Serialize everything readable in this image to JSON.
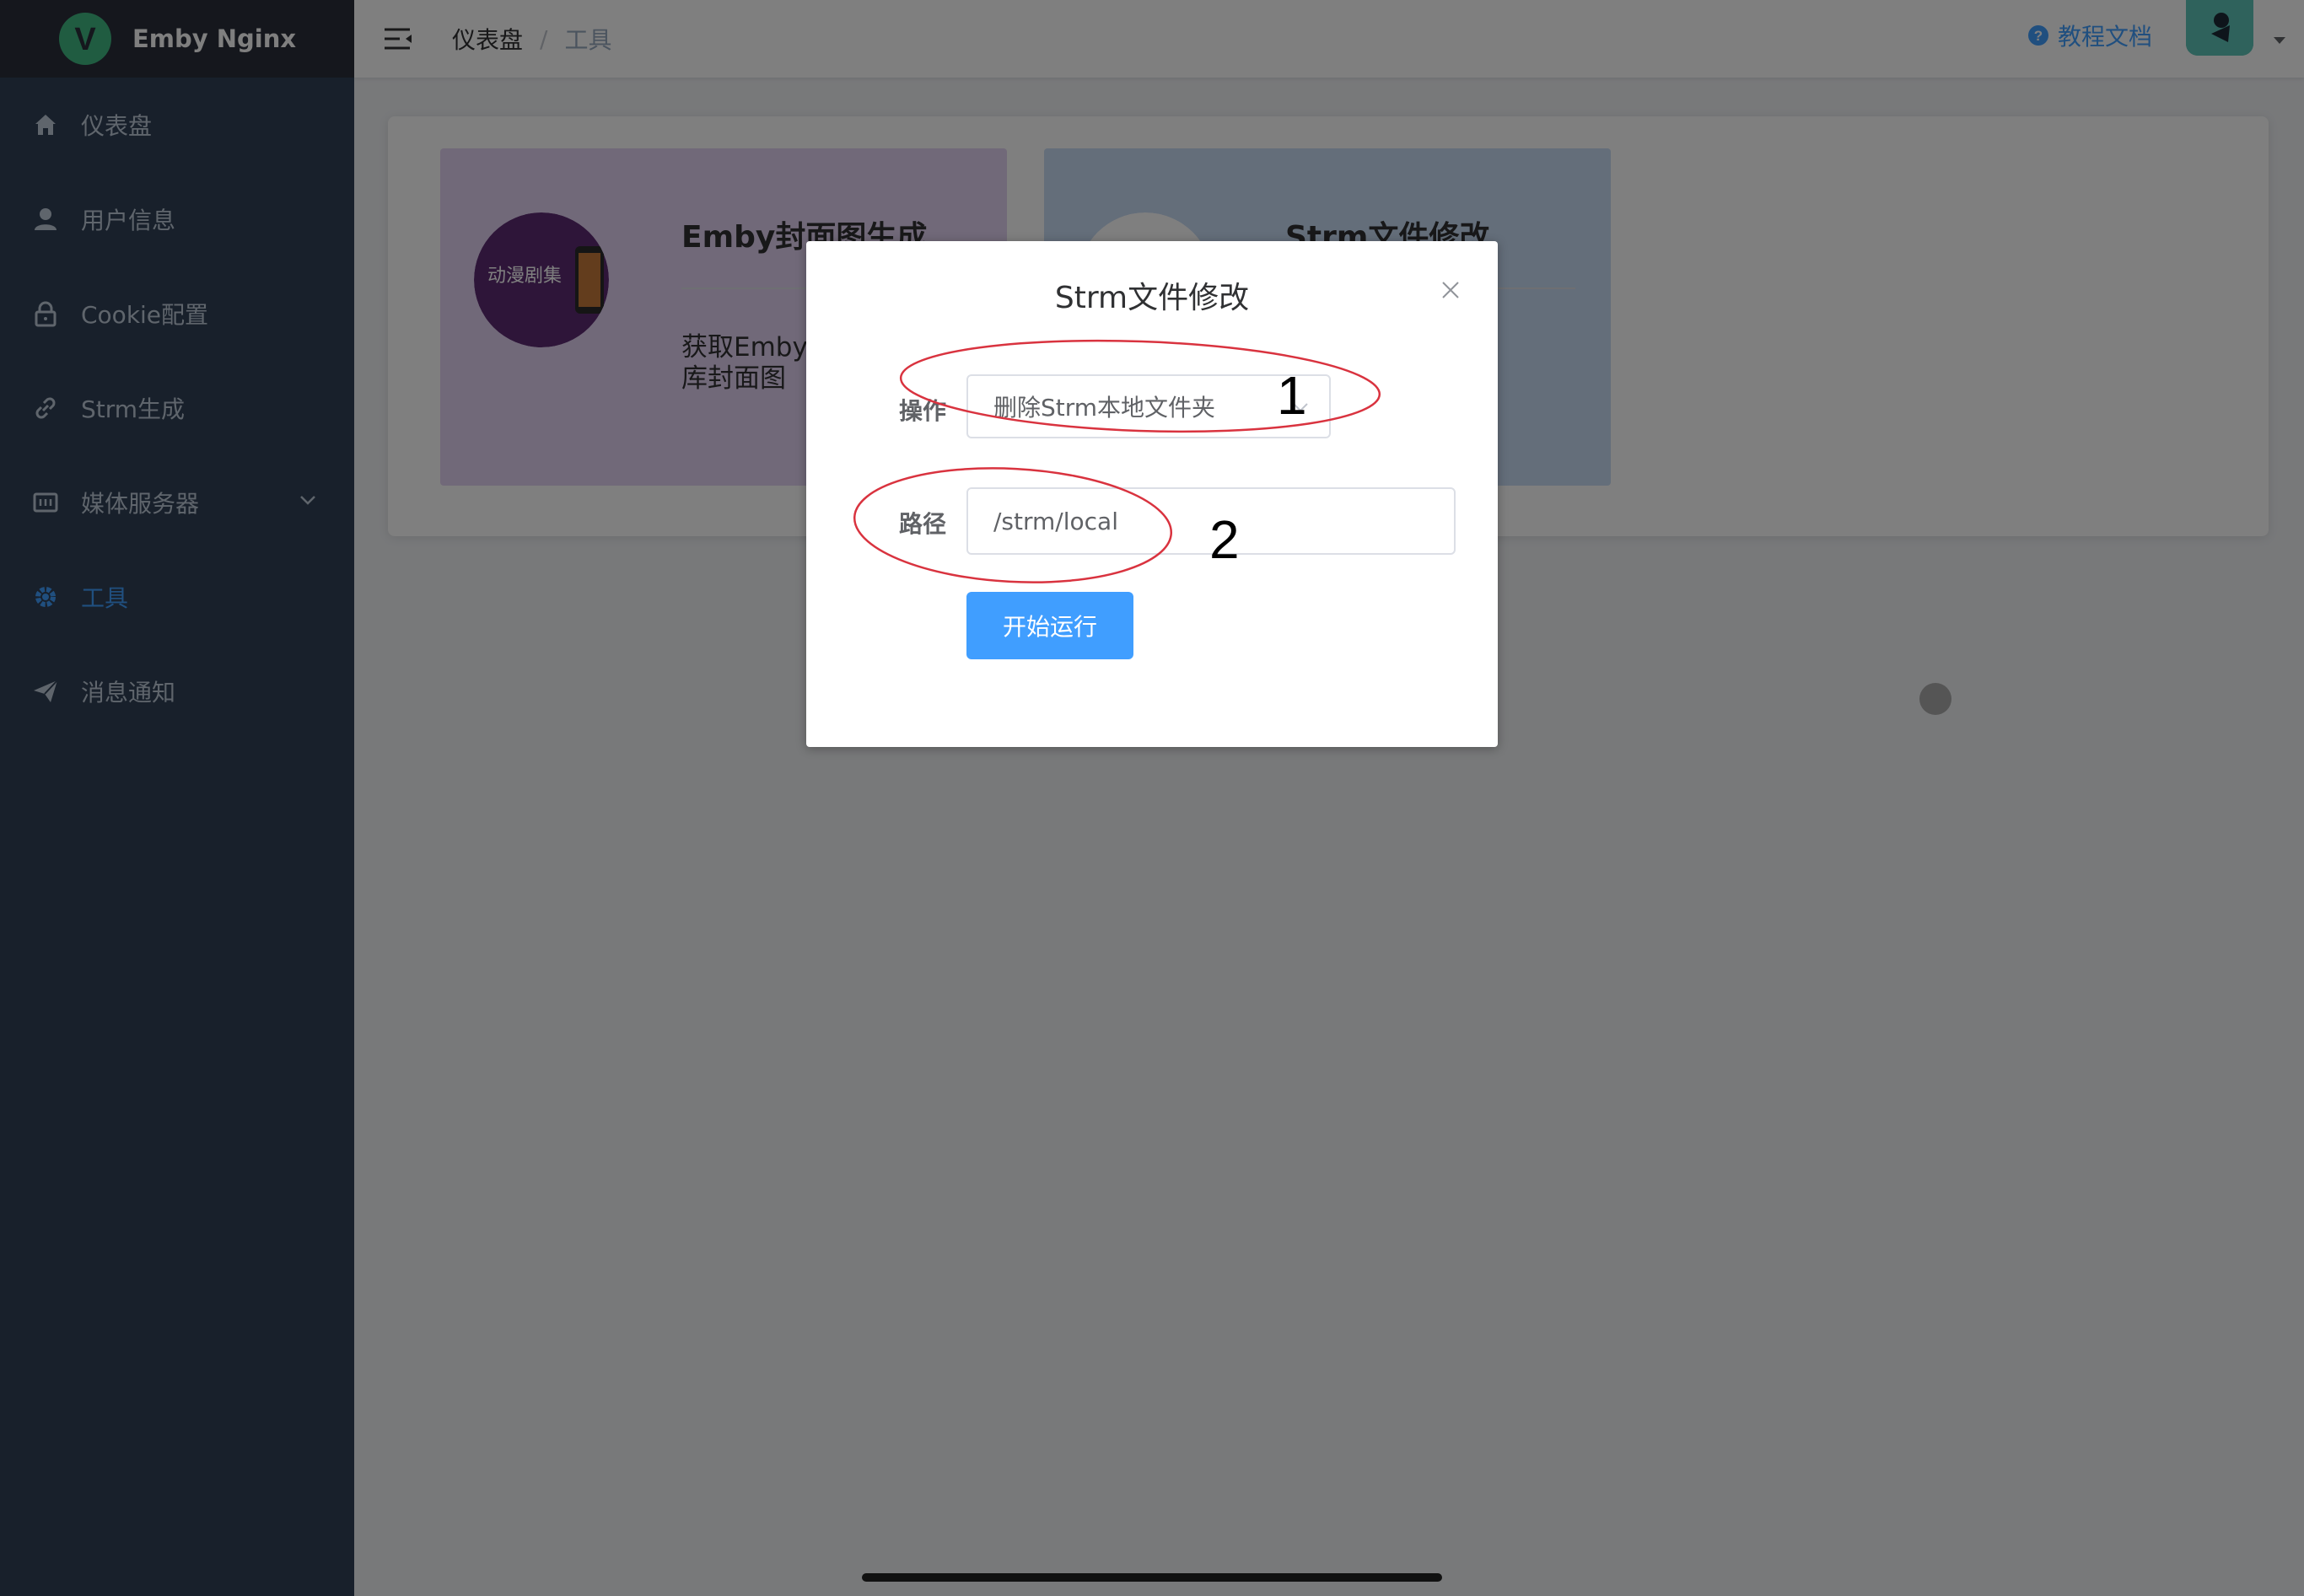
{
  "app": {
    "brand_title": "Emby Nginx"
  },
  "sidebar": {
    "items": [
      {
        "label": "仪表盘",
        "icon": "home-icon"
      },
      {
        "label": "用户信息",
        "icon": "user-icon"
      },
      {
        "label": "Cookie配置",
        "icon": "lock-icon"
      },
      {
        "label": "Strm生成",
        "icon": "link-icon"
      },
      {
        "label": "媒体服务器",
        "icon": "server-icon"
      },
      {
        "label": "工具",
        "icon": "gear-icon",
        "active": true
      },
      {
        "label": "消息通知",
        "icon": "send-icon"
      }
    ]
  },
  "header": {
    "breadcrumb": {
      "first": "仪表盘",
      "separator": "/",
      "current": "工具"
    },
    "doc_link": "教程文档"
  },
  "tools": {
    "cards": [
      {
        "title": "Emby封面图生成",
        "description": "获取Emby新入库封面体库封面图",
        "thumb_text": "动漫剧集",
        "bg_color": "#e3d3f2"
      },
      {
        "title": "Strm文件修改",
        "description": "",
        "bg_color": "#c9dcf5"
      }
    ]
  },
  "modal": {
    "title": "Strm文件修改",
    "operation_label": "操作",
    "operation_value": "删除Strm本地文件夹",
    "path_label": "路径",
    "path_value": "/strm/local",
    "run_button": "开始运行"
  },
  "annotations": {
    "label_1": "1",
    "label_2": "2",
    "color": "#d9333f"
  },
  "colors": {
    "accent": "#409eff",
    "sidebar_bg": "#304156",
    "brand_bg": "#2b2f3a"
  }
}
